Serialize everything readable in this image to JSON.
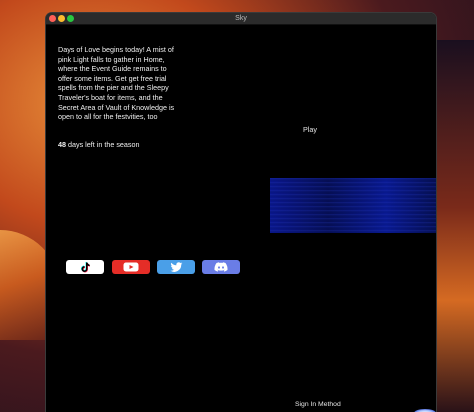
{
  "window": {
    "title": "Sky"
  },
  "news": {
    "text": "Days of Love begins today! A mist of pink Light falls to gather in Home, where the Event Guide remains to offer some items. Get get free trial spells from the pier and the Sleepy Traveler's boat for items, and the Secret Area of Vault of Knowledge is open to all for the festvities, too"
  },
  "season": {
    "days": "48",
    "suffix": " days left in the season"
  },
  "menu": {
    "play": "Play",
    "sign_in": "Sign In Method"
  },
  "social": [
    "tiktok-icon",
    "youtube-icon",
    "twitter-icon",
    "discord-icon"
  ],
  "colors": {
    "youtube": "#e52d27",
    "twitter": "#4a9fe8",
    "discord": "#6a7de6",
    "close": "#ff5f57",
    "minimize": "#febc2e",
    "maximize": "#28c840"
  }
}
